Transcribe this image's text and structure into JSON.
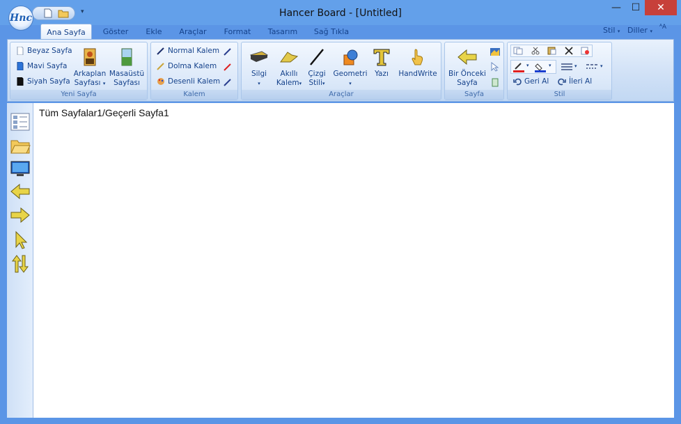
{
  "window": {
    "title": "Hancer Board - [Untitled]",
    "app_logo": "Hnc"
  },
  "window_controls": {
    "minimize": "—",
    "maximize": "☐",
    "close": "✕"
  },
  "tabs": [
    "Ana Sayfa",
    "Göster",
    "Ekle",
    "Araçlar",
    "Format",
    "Tasarım",
    "Sağ Tıkla"
  ],
  "right_menu": {
    "style": "Stil",
    "languages": "Diller",
    "font_size": "ᴬA"
  },
  "groups": {
    "yeni_sayfa": {
      "label": "Yeni Sayfa",
      "white": "Beyaz Sayfa",
      "blue": "Mavi Sayfa",
      "black": "Siyah Sayfa",
      "background_line1": "Arkaplan",
      "background_line2": "Sayfası",
      "desktop_line1": "Masaüstü",
      "desktop_line2": "Sayfası"
    },
    "kalem": {
      "label": "Kalem",
      "normal": "Normal Kalem",
      "fountain": "Dolma Kalem",
      "patterned": "Desenli Kalem"
    },
    "araclar": {
      "label": "Araçlar",
      "eraser": "Silgi",
      "smart_line1": "Akıllı",
      "smart_line2": "Kalem",
      "line_line1": "Çizgi",
      "line_line2": "Stili",
      "geometry": "Geometri",
      "text": "Yazı",
      "handwrite": "HandWrite"
    },
    "sayfa": {
      "label": "Sayfa",
      "prev_line1": "Bir Önceki",
      "prev_line2": "Sayfa"
    },
    "stil": {
      "label": "Stil",
      "undo": "Geri Al",
      "redo": "İleri Al"
    }
  },
  "canvas": {
    "page_info": "Tüm Sayfalar1/Geçerli Sayfa1"
  },
  "colors": {
    "accent": "#15428b",
    "title_bar": "#63a0ea",
    "close": "#c7403a",
    "pen_red": "#e02020",
    "fill_blue": "#1a3fd0"
  }
}
